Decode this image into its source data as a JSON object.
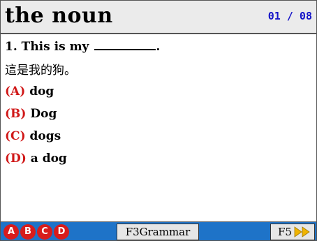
{
  "header": {
    "title": "the noun",
    "counter": "01 / 08"
  },
  "question": {
    "prefix": "1. This is my",
    "suffix": ".",
    "translation": "這是我的狗。"
  },
  "options": [
    {
      "letter": "(A)",
      "text": "dog"
    },
    {
      "letter": "(B)",
      "text": "Dog"
    },
    {
      "letter": "(C)",
      "text": "dogs"
    },
    {
      "letter": "(D)",
      "text": "a dog"
    }
  ],
  "footer": {
    "circles": [
      "A",
      "B",
      "C",
      "D"
    ],
    "f3_label": "F3Grammar",
    "f5_label": "F5",
    "f5_icon": "double-arrow-right-icon"
  },
  "colors": {
    "header_bg": "#ebebeb",
    "counter": "#1414c8",
    "option_letter": "#d01818",
    "footer_bg": "#1e73c8",
    "circle_bg": "#d81c1c",
    "button_bg": "#e6e6e6",
    "arrow": "#f0b400"
  }
}
